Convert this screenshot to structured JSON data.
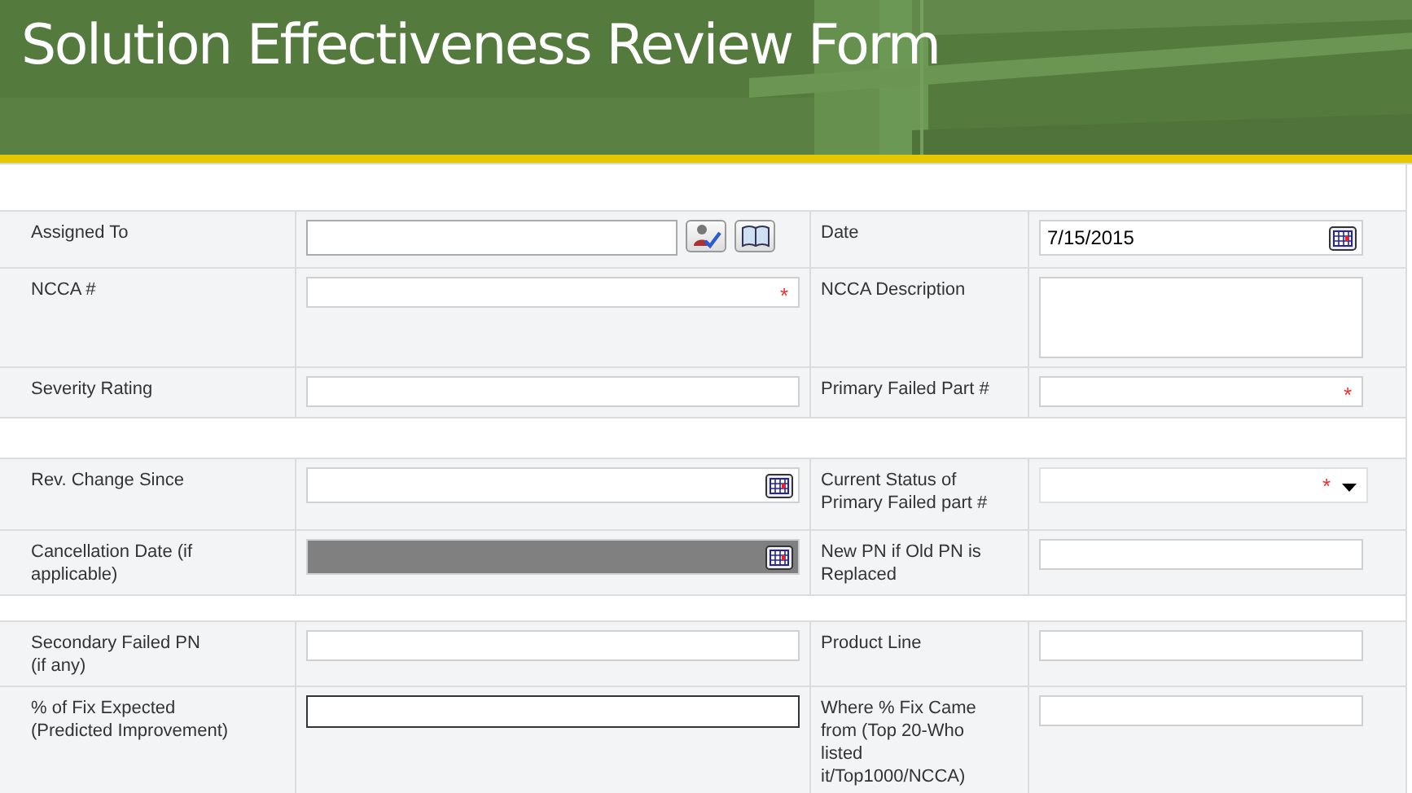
{
  "header": {
    "title": "Solution Effectiveness Review Form"
  },
  "sections": [
    {
      "rows": [
        {
          "cells": [
            {
              "label": "Assigned To",
              "field": {
                "kind": "people"
              }
            },
            {
              "label": "Date",
              "field": {
                "kind": "date",
                "value": "7/15/2015"
              }
            }
          ]
        },
        {
          "cells": [
            {
              "label": "NCCA #",
              "field": {
                "kind": "text",
                "required_mark": "*"
              }
            },
            {
              "label": "NCCA Description",
              "field": {
                "kind": "textarea"
              }
            }
          ]
        },
        {
          "cells": [
            {
              "label": "Severity Rating",
              "field": {
                "kind": "text"
              }
            },
            {
              "label": "Primary Failed Part #",
              "field": {
                "kind": "text",
                "required_mark": "*"
              }
            }
          ]
        }
      ]
    },
    {
      "rows": [
        {
          "cells": [
            {
              "label": "Rev. Change Since",
              "field": {
                "kind": "date"
              }
            },
            {
              "label": "Current Status of Primary Failed part #",
              "field": {
                "kind": "select",
                "required_mark": "*"
              }
            }
          ]
        },
        {
          "cells": [
            {
              "label": "Cancellation Date (if applicable)",
              "field": {
                "kind": "date",
                "disabled": true
              }
            },
            {
              "label": "New PN if Old PN is Replaced",
              "field": {
                "kind": "text"
              }
            }
          ]
        }
      ]
    },
    {
      "rows": [
        {
          "cells": [
            {
              "label": "Secondary Failed PN\n(if any)",
              "field": {
                "kind": "text"
              }
            },
            {
              "label": "Product Line",
              "field": {
                "kind": "text"
              }
            }
          ]
        },
        {
          "cells": [
            {
              "label": "% of Fix Expected\n(Predicted Improvement)",
              "field": {
                "kind": "text",
                "focused": true
              }
            },
            {
              "label": "Where % Fix Came from (Top 20-Who listed it/Top1000/NCCA)",
              "field": {
                "kind": "text"
              }
            }
          ]
        }
      ]
    }
  ]
}
